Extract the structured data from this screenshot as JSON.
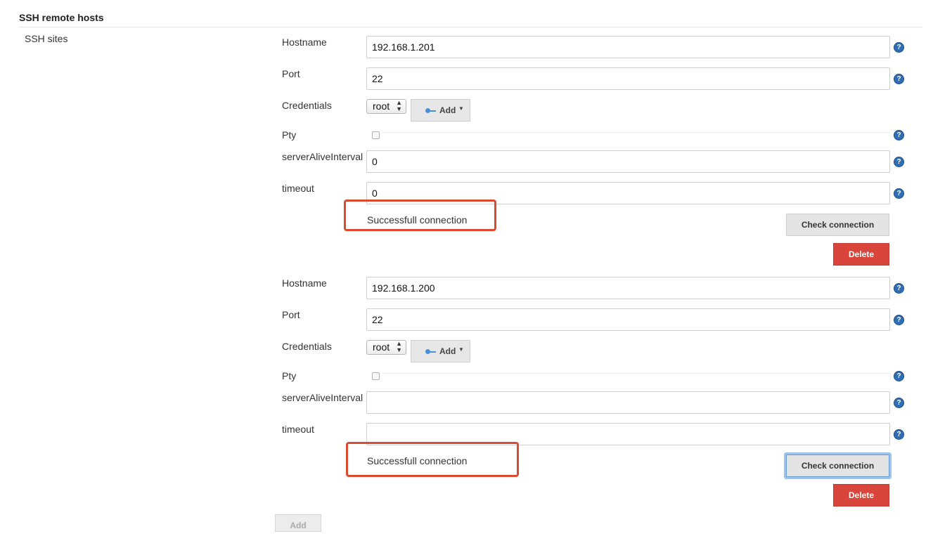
{
  "section": {
    "title": "SSH remote hosts",
    "sites_label": "SSH sites"
  },
  "labels": {
    "hostname": "Hostname",
    "port": "Port",
    "credentials": "Credentials",
    "pty": "Pty",
    "server_alive": "serverAliveInterval",
    "timeout": "timeout"
  },
  "help_glyph": "?",
  "credentials_add_label": "Add",
  "sites": [
    {
      "hostname": "192.168.1.201",
      "port": "22",
      "credentials_selected": "root",
      "pty_checked": false,
      "server_alive_interval": "0",
      "timeout": "0",
      "status": "Successfull connection",
      "check_label": "Check connection",
      "delete_label": "Delete"
    },
    {
      "hostname": "192.168.1.200",
      "port": "22",
      "credentials_selected": "root",
      "pty_checked": false,
      "server_alive_interval": "",
      "timeout": "",
      "status": "Successfull connection",
      "check_label": "Check connection",
      "delete_label": "Delete"
    }
  ],
  "add_site_label": "Add",
  "colors": {
    "highlight": "#dc4b2f",
    "delete": "#d9453b",
    "help": "#2f6db5",
    "focus_ring": "#9cc3ee"
  }
}
